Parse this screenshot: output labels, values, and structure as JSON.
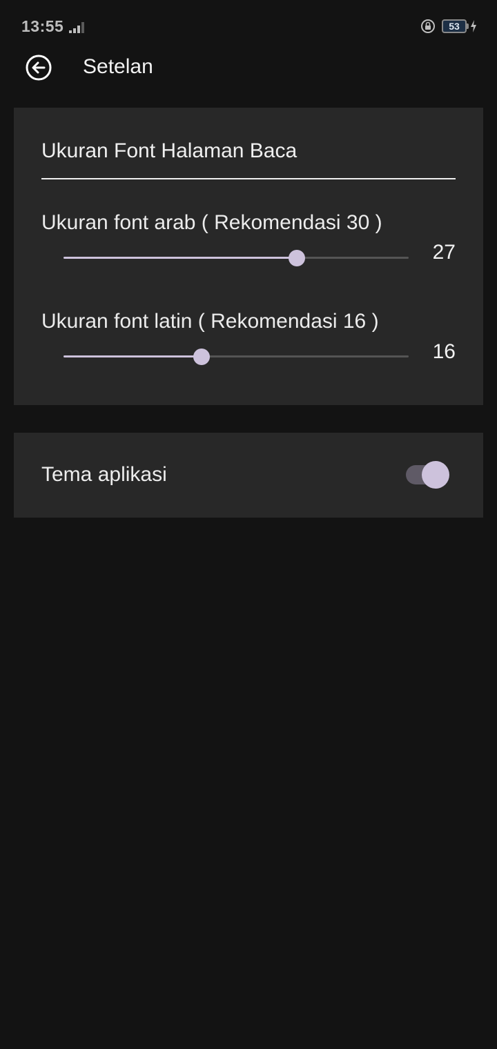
{
  "status_bar": {
    "time": "13:55",
    "battery_level": "53",
    "icons": [
      "signal-icon",
      "rotation-lock-icon",
      "battery-icon",
      "charging-bolt-icon"
    ]
  },
  "app_bar": {
    "title": "Setelan",
    "back_icon": "arrow-left-circle-icon"
  },
  "font_section": {
    "title": "Ukuran Font Halaman Baca",
    "arabic": {
      "label": "Ukuran font arab ( Rekomendasi 30 )",
      "value": "27",
      "fill_fraction": 0.676
    },
    "latin": {
      "label": "Ukuran font latin ( Rekomendasi 16 )",
      "value": "16",
      "fill_fraction": 0.4
    }
  },
  "theme_section": {
    "label": "Tema aplikasi",
    "toggle_on": true
  },
  "colors": {
    "background": "#131313",
    "card": "#282828",
    "accent": "#cdc2dc",
    "track_inactive": "#555555"
  }
}
